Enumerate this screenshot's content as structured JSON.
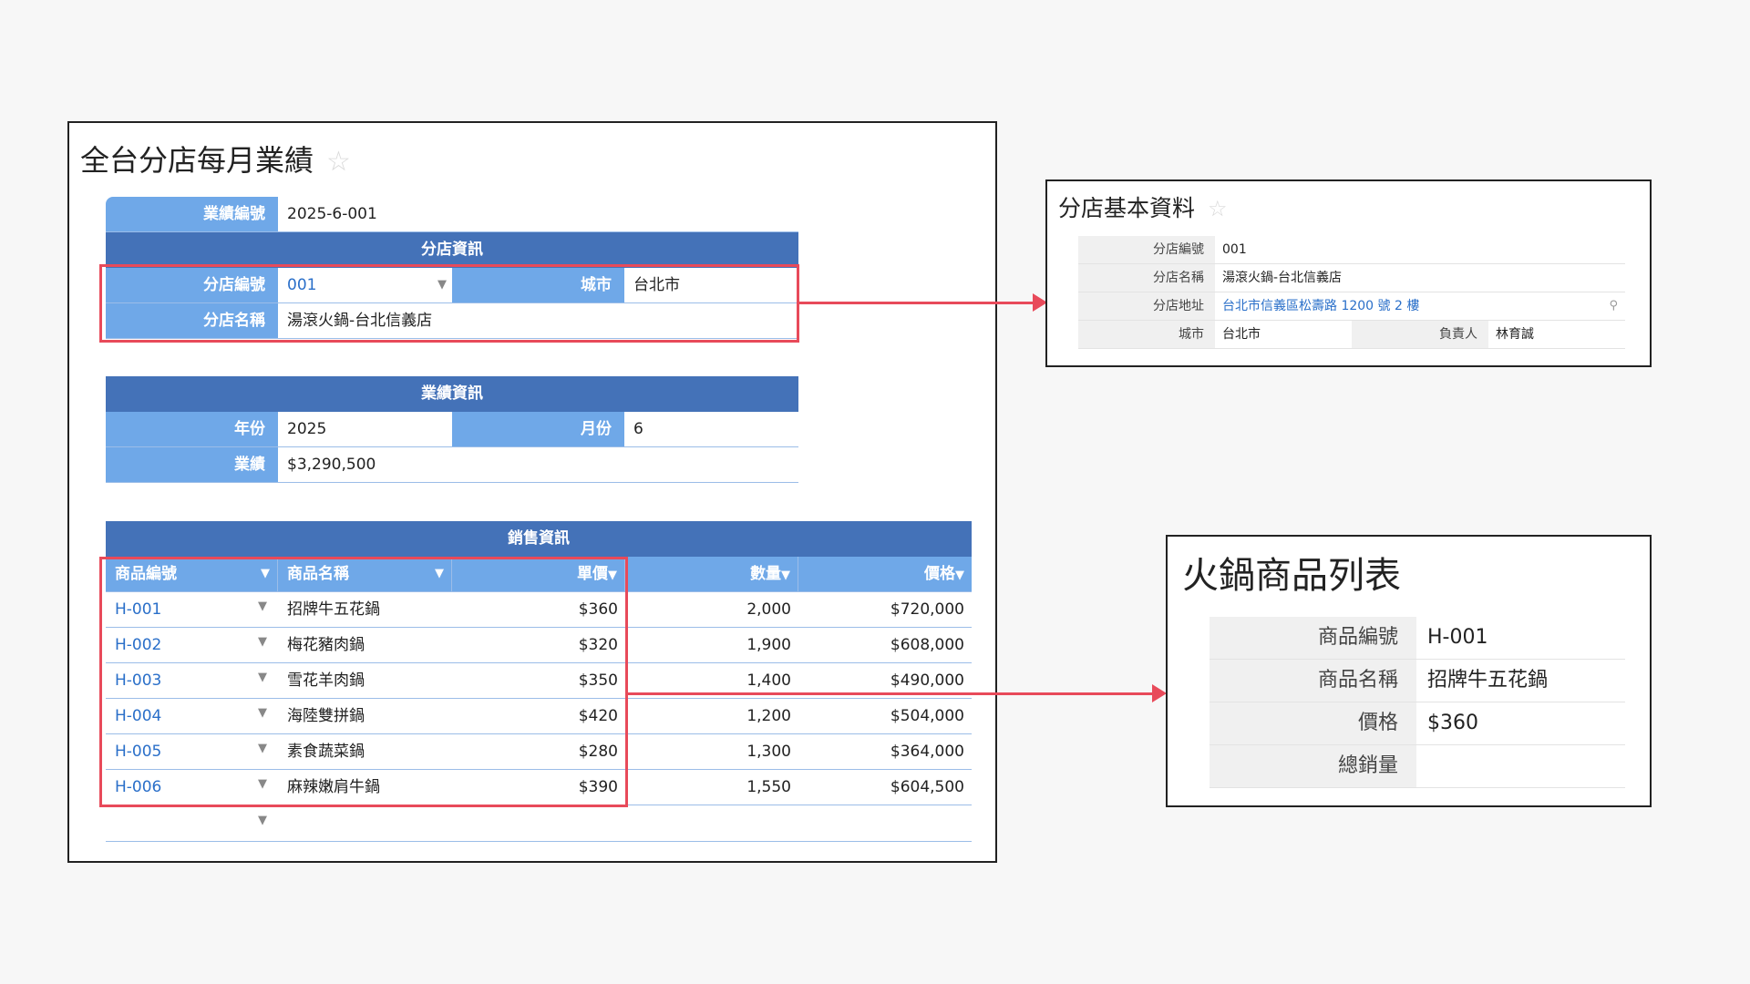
{
  "main": {
    "title": "全台分店每月業績",
    "record_no_label": "業績編號",
    "record_no_value": "2025-6-001",
    "branch_section": "分店資訊",
    "branch_code_label": "分店編號",
    "branch_code_value": "001",
    "city_label": "城市",
    "city_value": "台北市",
    "branch_name_label": "分店名稱",
    "branch_name_value": "湯滾火鍋-台北信義店",
    "perf_section": "業績資訊",
    "year_label": "年份",
    "year_value": "2025",
    "month_label": "月份",
    "month_value": "6",
    "revenue_label": "業績",
    "revenue_value": "$3,290,500"
  },
  "sales": {
    "section": "銷售資訊",
    "columns": [
      "商品編號",
      "商品名稱",
      "單價",
      "數量",
      "價格"
    ],
    "rows": [
      [
        "H-001",
        "招牌牛五花鍋",
        "$360",
        "2,000",
        "$720,000"
      ],
      [
        "H-002",
        "梅花豬肉鍋",
        "$320",
        "1,900",
        "$608,000"
      ],
      [
        "H-003",
        "雪花羊肉鍋",
        "$350",
        "1,400",
        "$490,000"
      ],
      [
        "H-004",
        "海陸雙拼鍋",
        "$420",
        "1,200",
        "$504,000"
      ],
      [
        "H-005",
        "素食蔬菜鍋",
        "$280",
        "1,300",
        "$364,000"
      ],
      [
        "H-006",
        "麻辣嫩肩牛鍋",
        "$390",
        "1,550",
        "$604,500"
      ]
    ]
  },
  "branch_card": {
    "title": "分店基本資料",
    "code_label": "分店編號",
    "code_value": "001",
    "name_label": "分店名稱",
    "name_value": "湯滾火鍋-台北信義店",
    "address_label": "分店地址",
    "address_value": "台北市信義區松壽路 1200 號 2 樓",
    "city_label": "城市",
    "city_value": "台北市",
    "manager_label": "負責人",
    "manager_value": "林育誠"
  },
  "product_card": {
    "title": "火鍋商品列表",
    "code_label": "商品編號",
    "code_value": "H-001",
    "name_label": "商品名稱",
    "name_value": "招牌牛五花鍋",
    "price_label": "價格",
    "price_value": "$360",
    "total_label": "總銷量",
    "total_value": ""
  },
  "colors": {
    "label_bg": "#6fa8e8",
    "header_bg": "#4472b8",
    "highlight": "#e84a5a",
    "link": "#2a6fc9"
  },
  "icons": [
    "star-icon",
    "dropdown-caret-icon",
    "map-pin-icon",
    "arrow-right-icon"
  ]
}
